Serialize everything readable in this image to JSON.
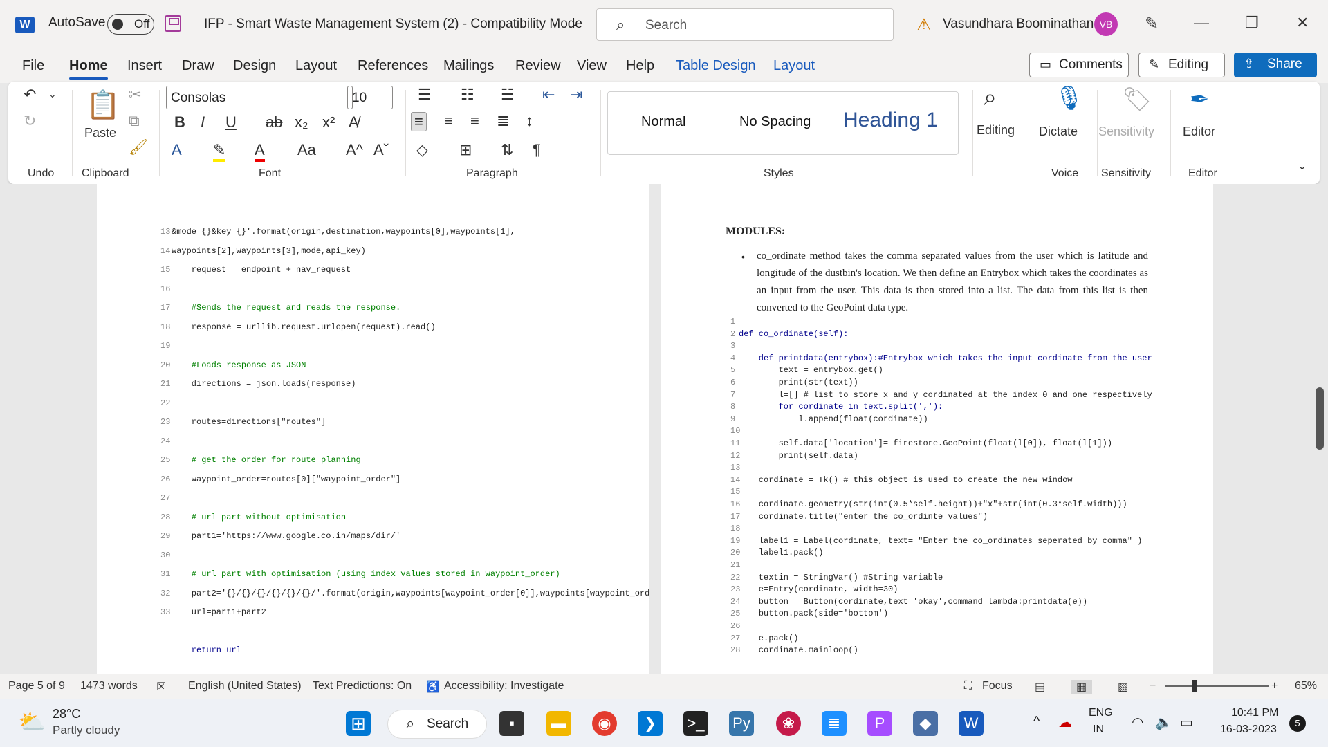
{
  "titlebar": {
    "autosave_label": "AutoSave",
    "autosave_state": "Off",
    "doc_title": "IFP - Smart Waste Management System (2)  -  Compatibility Mode",
    "search_placeholder": "Search",
    "user_name": "Vasundhara Boominathan",
    "user_initials": "VB"
  },
  "tabs": [
    "File",
    "Home",
    "Insert",
    "Draw",
    "Design",
    "Layout",
    "References",
    "Mailings",
    "Review",
    "View",
    "Help",
    "Table Design",
    "Layout"
  ],
  "buttons": {
    "comments": "Comments",
    "editing": "Editing",
    "share": "Share"
  },
  "ribbon": {
    "font_name": "Consolas",
    "font_size": "10",
    "paste": "Paste",
    "groups": {
      "undo": "Undo",
      "clipboard": "Clipboard",
      "font": "Font",
      "paragraph": "Paragraph",
      "styles": "Styles",
      "voice": "Voice",
      "sensitivity": "Sensitivity",
      "editor": "Editor"
    },
    "styles": [
      "Normal",
      "No Spacing",
      "Heading 1"
    ],
    "big": {
      "editing": "Editing",
      "dictate": "Dictate",
      "sensitivity": "Sensitivity",
      "editor": "Editor"
    }
  },
  "left_page": [
    {
      "n": "13",
      "t": "&mode={}&key={}'.format(origin,destination,waypoints[0],waypoints[1],"
    },
    {
      "n": "14",
      "t": "waypoints[2],waypoints[3],mode,api_key)"
    },
    {
      "n": "15",
      "t": "    request = endpoint + nav_request"
    },
    {
      "n": "16",
      "t": ""
    },
    {
      "n": "17",
      "t": "    #Sends the request and reads the response."
    },
    {
      "n": "18",
      "t": "    response = urllib.request.urlopen(request).read()"
    },
    {
      "n": "19",
      "t": ""
    },
    {
      "n": "20",
      "t": "    #Loads response as JSON"
    },
    {
      "n": "21",
      "t": "    directions = json.loads(response)"
    },
    {
      "n": "22",
      "t": ""
    },
    {
      "n": "23",
      "t": "    routes=directions[\"routes\"]"
    },
    {
      "n": "24",
      "t": ""
    },
    {
      "n": "25",
      "t": "    # get the order for route planning"
    },
    {
      "n": "26",
      "t": "    waypoint_order=routes[0][\"waypoint_order\"]"
    },
    {
      "n": "27",
      "t": ""
    },
    {
      "n": "28",
      "t": "    # url part without optimisation"
    },
    {
      "n": "29",
      "t": "    part1='https://www.google.co.in/maps/dir/'"
    },
    {
      "n": "30",
      "t": ""
    },
    {
      "n": "31",
      "t": "    # url part with optimisation (using index values stored in waypoint_order)"
    },
    {
      "n": "32",
      "t": "    part2='{}/{}/{}/{}/{}/{}/'.format(origin,waypoints[waypoint_order[0]],waypoints[waypoint_ord"
    },
    {
      "n": "33",
      "t": "    url=part1+part2"
    },
    {
      "n": "",
      "t": ""
    },
    {
      "n": "",
      "t": "    return url"
    }
  ],
  "right_page": {
    "heading": "MODULES:",
    "paragraph": "co_ordinate method takes the comma separated values from the user which is latitude and longitude of the dustbin's location. We then define an Entrybox which takes the coordinates as an input from the user. This data is then stored into a list. The data from this list is then converted to the GeoPoint data type.",
    "code": [
      {
        "n": "1",
        "t": ""
      },
      {
        "n": "2",
        "t": "def co_ordinate(self):"
      },
      {
        "n": "3",
        "t": ""
      },
      {
        "n": "4",
        "t": "    def printdata(entrybox):#Entrybox which takes the input cordinate from the user"
      },
      {
        "n": "5",
        "t": "        text = entrybox.get()"
      },
      {
        "n": "6",
        "t": "        print(str(text))"
      },
      {
        "n": "7",
        "t": "        l=[] # list to store x and y cordinated at the index 0 and one respectively"
      },
      {
        "n": "8",
        "t": "        for cordinate in text.split(','):"
      },
      {
        "n": "9",
        "t": "            l.append(float(cordinate))"
      },
      {
        "n": "10",
        "t": ""
      },
      {
        "n": "11",
        "t": "        self.data['location']= firestore.GeoPoint(float(l[0]), float(l[1]))"
      },
      {
        "n": "12",
        "t": "        print(self.data)"
      },
      {
        "n": "13",
        "t": ""
      },
      {
        "n": "14",
        "t": "    cordinate = Tk() # this object is used to create the new window"
      },
      {
        "n": "15",
        "t": ""
      },
      {
        "n": "16",
        "t": "    cordinate.geometry(str(int(0.5*self.height))+\"x\"+str(int(0.3*self.width)))"
      },
      {
        "n": "17",
        "t": "    cordinate.title(\"enter the co_ordinte values\")"
      },
      {
        "n": "18",
        "t": ""
      },
      {
        "n": "19",
        "t": "    label1 = Label(cordinate, text= \"Enter the co_ordinates seperated by comma\" )"
      },
      {
        "n": "20",
        "t": "    label1.pack()"
      },
      {
        "n": "21",
        "t": ""
      },
      {
        "n": "22",
        "t": "    textin = StringVar() #String variable"
      },
      {
        "n": "23",
        "t": "    e=Entry(cordinate, width=30)"
      },
      {
        "n": "24",
        "t": "    button = Button(cordinate,text='okay',command=lambda:printdata(e))"
      },
      {
        "n": "25",
        "t": "    button.pack(side='bottom')"
      },
      {
        "n": "26",
        "t": ""
      },
      {
        "n": "27",
        "t": "    e.pack()"
      },
      {
        "n": "28",
        "t": "    cordinate.mainloop()"
      }
    ]
  },
  "status": {
    "page": "Page 5 of 9",
    "words": "1473 words",
    "language": "English (United States)",
    "predictions": "Text Predictions: On",
    "accessibility": "Accessibility: Investigate",
    "focus": "Focus",
    "zoom": "65%"
  },
  "taskbar": {
    "temp": "28°C",
    "weather": "Partly cloudy",
    "search": "Search",
    "lang1": "ENG",
    "lang2": "IN",
    "time": "10:41 PM",
    "date": "16-03-2023",
    "notif": "5"
  }
}
